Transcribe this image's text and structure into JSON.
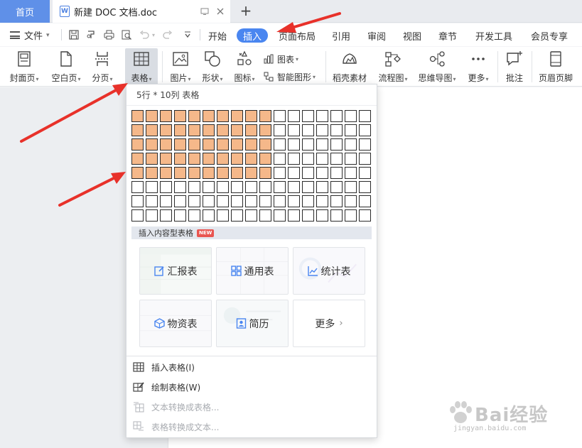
{
  "titlebar": {
    "home_tab": "首页",
    "doc_title": "新建 DOC 文档.doc",
    "doc_icon_letter": "W",
    "new_tab_symbol": "+"
  },
  "menu": {
    "file_label": "文件",
    "tabs": [
      {
        "label": "开始",
        "active": false
      },
      {
        "label": "插入",
        "active": true
      },
      {
        "label": "页面布局",
        "active": false
      },
      {
        "label": "引用",
        "active": false
      },
      {
        "label": "审阅",
        "active": false
      },
      {
        "label": "视图",
        "active": false
      },
      {
        "label": "章节",
        "active": false
      },
      {
        "label": "开发工具",
        "active": false
      },
      {
        "label": "会员专享",
        "active": false
      }
    ]
  },
  "ribbon": {
    "cover_page": "封面页",
    "blank_page": "空白页",
    "page_break": "分页",
    "table": "表格",
    "picture": "图片",
    "shape": "形状",
    "icon": "图标",
    "chart": "图表",
    "smart_graphic": "智能图形",
    "docer_material": "稻壳素材",
    "flowchart": "流程图",
    "mindmap": "思维导图",
    "more": "更多",
    "comment": "批注",
    "header_footer": "页眉页脚"
  },
  "table_panel": {
    "grid_label": "5行 * 10列 表格",
    "grid_rows": 8,
    "grid_cols": 17,
    "selected_rows": 5,
    "selected_cols": 10,
    "content_section_title": "插入内容型表格",
    "new_badge": "NEW",
    "cards": [
      "汇报表",
      "通用表",
      "统计表",
      "物资表",
      "简历",
      "更多"
    ],
    "menu_items": [
      {
        "label": "插入表格(I)",
        "enabled": true
      },
      {
        "label": "绘制表格(W)",
        "enabled": true
      },
      {
        "label": "文本转换成表格...",
        "enabled": false
      },
      {
        "label": "表格转换成文本...",
        "enabled": false
      }
    ]
  },
  "watermark": {
    "text": "Bai经验",
    "sub": "jingyan.baidu.com"
  },
  "colors": {
    "accent": "#4a86f0",
    "selected_cell": "#f5b88a",
    "annotation_arrow": "#e8312a"
  }
}
